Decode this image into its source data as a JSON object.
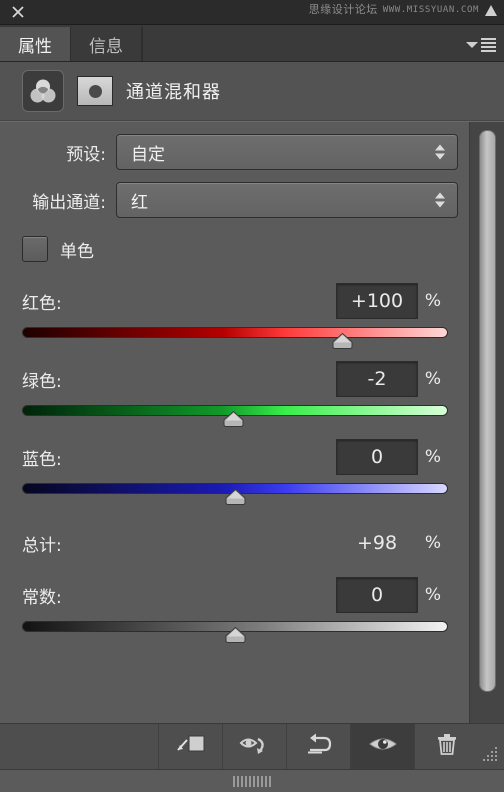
{
  "titlebar": {
    "close_icon": "close-icon",
    "watermark_cn": "思缘设计论坛",
    "watermark_en": "WWW.MISSYUAN.COM"
  },
  "tabs": [
    {
      "label": "属性",
      "active": true
    },
    {
      "label": "信息",
      "active": false
    }
  ],
  "panel_menu": {
    "chevron_icon": "chevron-down-icon",
    "menu_icon": "hamburger-menu-icon"
  },
  "adjustment_header": {
    "icon": "channel-mixer-icon",
    "mask_icon": "layer-mask-thumbnail",
    "title": "通道混和器"
  },
  "selects": [
    {
      "label": "预设:",
      "value": "自定",
      "stepper_icon": "stepper-arrows-icon"
    },
    {
      "label": "输出通道:",
      "value": "红",
      "stepper_icon": "stepper-arrows-icon"
    }
  ],
  "monochrome": {
    "label": "单色",
    "checked": false
  },
  "sliders": [
    {
      "label": "红色:",
      "value": "+100",
      "unit": "%",
      "percent": 75,
      "color": "red",
      "boxed": true
    },
    {
      "label": "绿色:",
      "value": "-2",
      "unit": "%",
      "percent": 49.5,
      "color": "green",
      "boxed": true
    },
    {
      "label": "蓝色:",
      "value": "0",
      "unit": "%",
      "percent": 50,
      "color": "blue",
      "boxed": true
    }
  ],
  "total": {
    "label": "总计:",
    "value": "+98",
    "unit": "%"
  },
  "constant": {
    "label": "常数:",
    "value": "0",
    "unit": "%",
    "percent": 50,
    "color": "gray"
  },
  "toolbar": [
    {
      "icon": "clip-to-layer-icon",
      "active": false
    },
    {
      "icon": "toggle-layer-visibility-icon",
      "active": false
    },
    {
      "icon": "reset-icon",
      "active": false
    },
    {
      "icon": "eye-icon",
      "active": true
    },
    {
      "icon": "trash-icon",
      "active": false
    }
  ],
  "resize_grip_icon": "resize-grip-icon",
  "drag_bar_icon": "drag-handle-icon",
  "scrollbar": {
    "icon": "vertical-scrollbar-thumb"
  },
  "colors": {
    "panel_bg": "#5b5b5b",
    "header_bg": "#535353",
    "titlebar_bg": "#2b2b2b",
    "tab_active": "#535353",
    "tab_inactive": "#3a3a3a",
    "input_bg": "#3a3a3a",
    "text": "#ededed"
  }
}
